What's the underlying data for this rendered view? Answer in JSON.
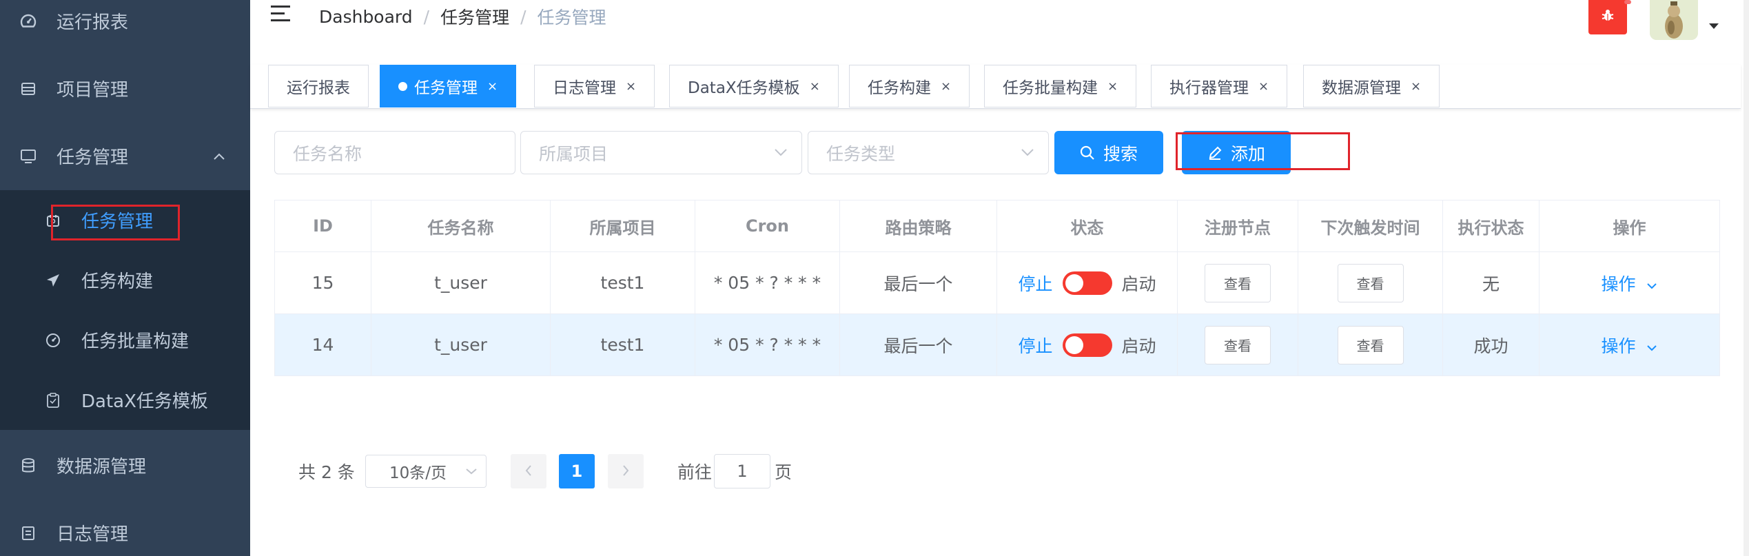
{
  "sidebar": {
    "items": [
      {
        "label": "运行报表",
        "icon": "dashboard-icon"
      },
      {
        "label": "项目管理",
        "icon": "project-icon"
      },
      {
        "label": "任务管理",
        "icon": "monitor-icon"
      },
      {
        "label": "数据源管理",
        "icon": "database-icon"
      },
      {
        "label": "日志管理",
        "icon": "log-icon"
      }
    ],
    "submenu": [
      {
        "label": "任务管理",
        "icon": "calendar-icon",
        "active": true
      },
      {
        "label": "任务构建",
        "icon": "send-icon"
      },
      {
        "label": "任务批量构建",
        "icon": "gauge-icon"
      },
      {
        "label": "DataX任务模板",
        "icon": "clipboard-icon"
      }
    ]
  },
  "navbar": {
    "breadcrumb": [
      "Dashboard",
      "任务管理",
      "任务管理"
    ],
    "bug_color": "#f5392f"
  },
  "tags": [
    {
      "label": "运行报表",
      "closable": false,
      "active": false
    },
    {
      "label": "任务管理",
      "closable": true,
      "active": true
    },
    {
      "label": "日志管理",
      "closable": true,
      "active": false
    },
    {
      "label": "DataX任务模板",
      "closable": true,
      "active": false
    },
    {
      "label": "任务构建",
      "closable": true,
      "active": false
    },
    {
      "label": "任务批量构建",
      "closable": true,
      "active": false
    },
    {
      "label": "执行器管理",
      "closable": true,
      "active": false
    },
    {
      "label": "数据源管理",
      "closable": true,
      "active": false
    }
  ],
  "filters": {
    "task_name_placeholder": "任务名称",
    "project_placeholder": "所属项目",
    "task_type_placeholder": "任务类型",
    "search_label": "搜索",
    "add_label": "添加"
  },
  "table": {
    "headers": [
      "ID",
      "任务名称",
      "所属项目",
      "Cron",
      "路由策略",
      "状态",
      "注册节点",
      "下次触发时间",
      "执行状态",
      "操作"
    ],
    "rows": [
      {
        "id": "15",
        "name": "t_user",
        "project": "test1",
        "cron": "* 05 * ? * * *",
        "route": "最后一个",
        "stop": "停止",
        "start": "启动",
        "node_btn": "查看",
        "next_btn": "查看",
        "exec_status": "无",
        "op": "操作"
      },
      {
        "id": "14",
        "name": "t_user",
        "project": "test1",
        "cron": "* 05 * ? * * *",
        "route": "最后一个",
        "stop": "停止",
        "start": "启动",
        "node_btn": "查看",
        "next_btn": "查看",
        "exec_status": "成功",
        "op": "操作"
      }
    ]
  },
  "pagination": {
    "total_text": "共 2 条",
    "page_size": "10条/页",
    "current_page": "1",
    "goto_prefix": "前往",
    "goto_value": "1",
    "goto_suffix": "页"
  },
  "colors": {
    "sidebar_bg": "#304156",
    "submenu_bg": "#1f2d3d",
    "primary": "#1890ff",
    "switch_off": "#f5392f",
    "highlight_box": "#e0242b"
  }
}
